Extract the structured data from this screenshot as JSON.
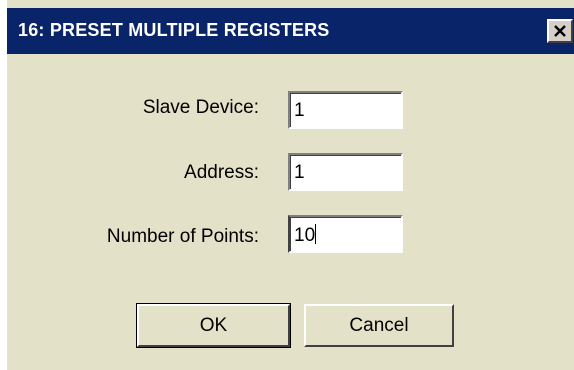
{
  "dialog": {
    "title": "16: PRESET MULTIPLE REGISTERS",
    "close_symbol": "✕"
  },
  "fields": {
    "slave_device": {
      "label": "Slave Device:",
      "value": "1"
    },
    "address": {
      "label": "Address:",
      "value": "1"
    },
    "number_of_points": {
      "label": "Number of Points:",
      "value": "10"
    }
  },
  "buttons": {
    "ok_label": "OK",
    "cancel_label": "Cancel"
  },
  "colors": {
    "titlebar": "#0a246a",
    "dialog_background": "#e4e1c9"
  },
  "icons": {
    "close": "close-icon"
  }
}
